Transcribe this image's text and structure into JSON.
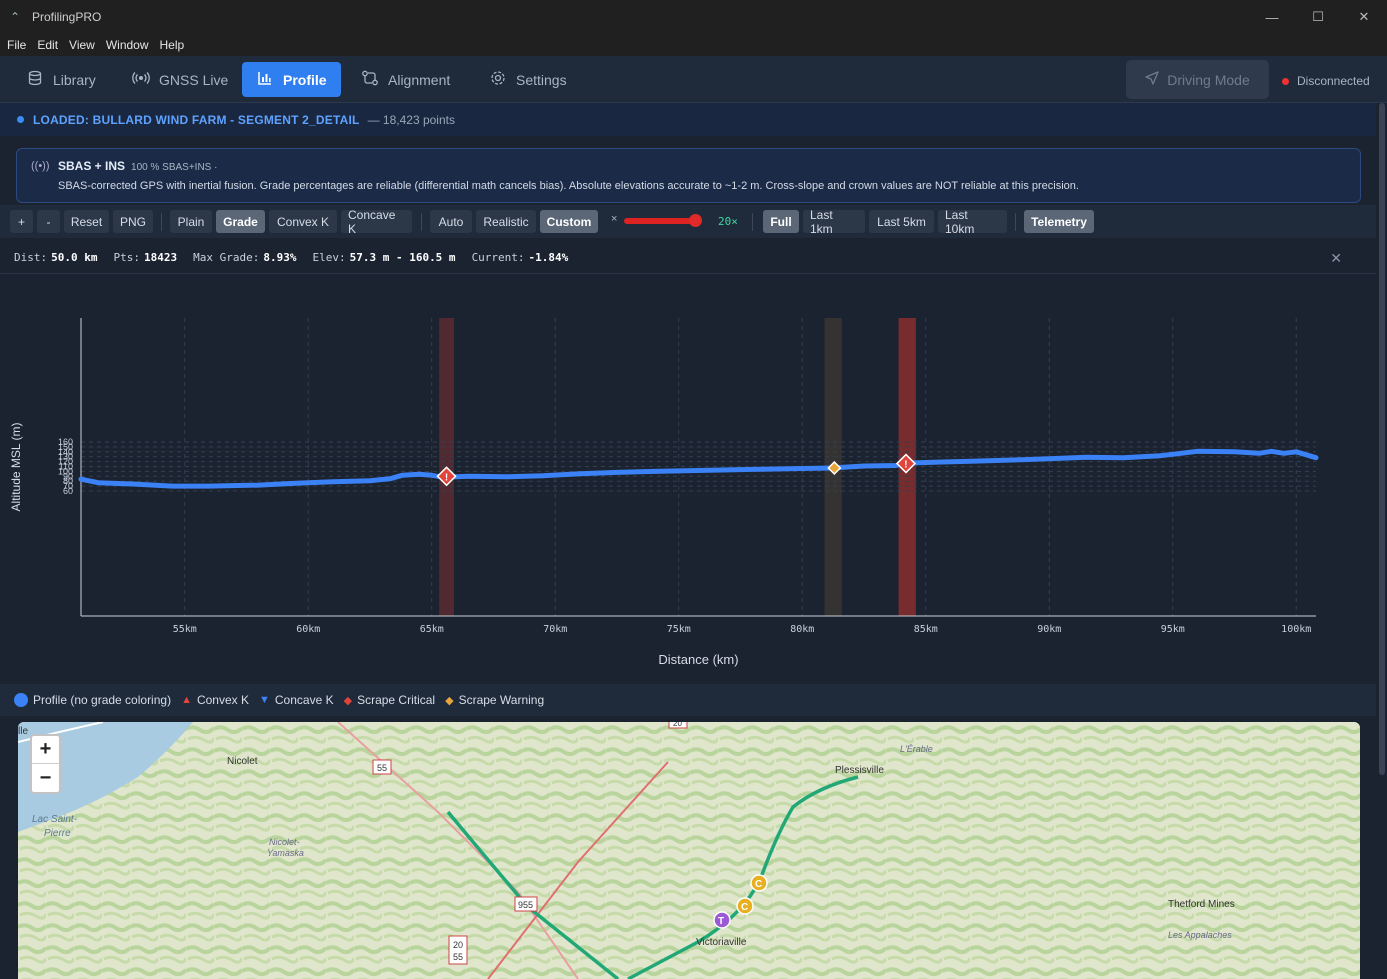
{
  "window": {
    "title": "ProfilingPRO"
  },
  "menu": [
    "File",
    "Edit",
    "View",
    "Window",
    "Help"
  ],
  "nav": {
    "items": [
      {
        "label": "Library",
        "icon": "database-icon"
      },
      {
        "label": "GNSS Live",
        "icon": "broadcast-icon"
      },
      {
        "label": "Profile",
        "icon": "bar-chart-icon",
        "active": true
      },
      {
        "label": "Alignment",
        "icon": "route-icon"
      },
      {
        "label": "Settings",
        "icon": "gear-icon"
      }
    ],
    "driving_mode": "Driving Mode",
    "connection": "Disconnected"
  },
  "loaded": {
    "name": "LOADED: BULLARD WIND FARM - SEGMENT 2_DETAIL",
    "points": "— 18,423 points"
  },
  "sbas": {
    "title": "SBAS + INS",
    "sub": "100 % SBAS+INS ·",
    "desc": "SBAS-corrected GPS with inertial fusion. Grade percentages are reliable (differential math cancels bias). Absolute elevations accurate to ~1-2 m. Cross-slope and crown values are NOT reliable at this precision."
  },
  "toolbar": {
    "zoom_in": "+",
    "zoom_out": "-",
    "reset": "Reset",
    "png": "PNG",
    "plain": "Plain",
    "grade": "Grade",
    "convex": "Convex K",
    "concave": "Concave K",
    "auto": "Auto",
    "realistic": "Realistic",
    "custom": "Custom",
    "exag_x": "×",
    "exag_value": "20×",
    "exag_level": 1.0,
    "full": "Full",
    "last1": "Last 1km",
    "last5": "Last 5km",
    "last10": "Last 10km",
    "telemetry": "Telemetry"
  },
  "stats": {
    "dist_label": "Dist:",
    "dist": "50.0 km",
    "pts_label": "Pts:",
    "pts": "18423",
    "maxgrade_label": "Max Grade:",
    "maxgrade": "8.93%",
    "elev_label": "Elev:",
    "elev": "57.3 m - 160.5 m",
    "current_label": "Current:",
    "current": "-1.84%"
  },
  "chart_data": {
    "type": "line",
    "xlabel": "Distance (km)",
    "ylabel": "Altitude MSL (m)",
    "xlim": [
      50.8,
      100.8
    ],
    "x_ticks": [
      55,
      60,
      65,
      70,
      75,
      80,
      85,
      90,
      95,
      100
    ],
    "x_tick_labels": [
      "55km",
      "60km",
      "65km",
      "70km",
      "75km",
      "80km",
      "85km",
      "90km",
      "95km",
      "100km"
    ],
    "y_ticks": [
      60,
      70,
      80,
      90,
      100,
      110,
      120,
      130,
      140,
      150,
      160
    ],
    "y_tick_labels": [
      "60",
      "70",
      "80",
      "90",
      "100",
      "110",
      "120",
      "130",
      "140",
      "150",
      "160"
    ],
    "series": [
      {
        "name": "Profile (no grade coloring)",
        "color": "#3b82f6",
        "x": [
          50.8,
          51.5,
          53,
          54.5,
          56,
          58,
          59.5,
          61,
          62.5,
          63.3,
          63.8,
          64.5,
          65,
          65.5,
          66.5,
          68,
          69.5,
          71,
          72.5,
          74,
          76,
          78,
          80,
          81.2,
          82.5,
          83.8,
          84.2,
          85.5,
          87,
          89,
          90.5,
          91.5,
          93,
          94.5,
          95,
          96,
          97.5,
          98.5,
          99,
          99.5,
          100,
          100.8
        ],
        "y": [
          84,
          77,
          74,
          70,
          70,
          72,
          76,
          79,
          81,
          85,
          92,
          94,
          92,
          88,
          90,
          89,
          91,
          95,
          98,
          100,
          102,
          104,
          106,
          107,
          111,
          112,
          117,
          119,
          121,
          124,
          127,
          129,
          128,
          132,
          135,
          141,
          140,
          137,
          141,
          137,
          140,
          128
        ]
      }
    ],
    "bands": [
      {
        "x0": 65.3,
        "x1": 65.9,
        "color": "#5a2a30",
        "kind": "Scrape Critical"
      },
      {
        "x0": 80.9,
        "x1": 81.6,
        "color": "#3a3632",
        "kind": "Scrape Warning"
      },
      {
        "x0": 83.9,
        "x1": 84.6,
        "color": "#8a2e2e",
        "kind": "Scrape Critical"
      }
    ],
    "markers": [
      {
        "x": 65.6,
        "y": 90,
        "kind": "Scrape Critical",
        "color": "#e0443a"
      },
      {
        "x": 81.3,
        "y": 107,
        "kind": "Scrape Warning",
        "color": "#e8a53a"
      },
      {
        "x": 84.2,
        "y": 116,
        "kind": "Scrape Critical",
        "color": "#e0443a"
      }
    ],
    "legend": [
      {
        "label": "Profile (no grade coloring)",
        "symbol": "●",
        "color": "#3b82f6"
      },
      {
        "label": "Convex K",
        "symbol": "▲",
        "color": "#e0443a"
      },
      {
        "label": "Concave K",
        "symbol": "▼",
        "color": "#3b82f6"
      },
      {
        "label": "Scrape Critical",
        "symbol": "◆",
        "color": "#e0443a"
      },
      {
        "label": "Scrape Warning",
        "symbol": "◆",
        "color": "#e8a53a"
      }
    ],
    "grid": true
  },
  "map": {
    "zoom_in": "+",
    "zoom_out": "−",
    "labels": [
      {
        "text": "Nicolet"
      },
      {
        "text": "Plessisville"
      },
      {
        "text": "L'Érable"
      },
      {
        "text": "Lac Saint-"
      },
      {
        "text": "Pierre"
      },
      {
        "text": "Nicolet-"
      },
      {
        "text": "Yamaska"
      },
      {
        "text": "Victoriaville"
      },
      {
        "text": "Thetford Mines"
      },
      {
        "text": "Les Appalaches"
      },
      {
        "text": "lle"
      }
    ],
    "shields": [
      "55",
      "955",
      "20",
      "55",
      "20"
    ],
    "pins": [
      {
        "letter": "C",
        "color": "#e8b020"
      },
      {
        "letter": "C",
        "color": "#e8b020"
      },
      {
        "letter": "T",
        "color": "#9b59d6"
      }
    ]
  }
}
